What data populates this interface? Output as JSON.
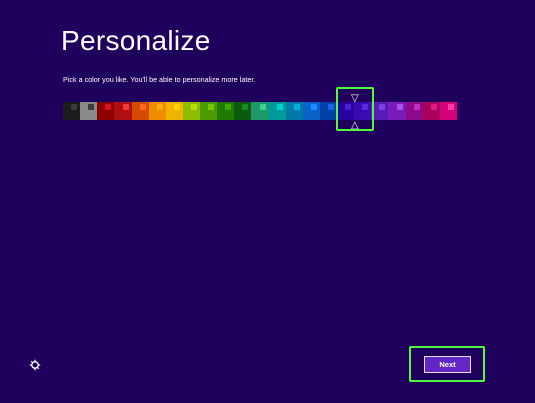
{
  "page": {
    "title": "Personalize",
    "subtitle": "Pick a color you like. You'll be able to personalize more later."
  },
  "colors": {
    "background": "#1f005d",
    "highlight": "#4cff3a",
    "button_fill": "#6327c8"
  },
  "swatches": [
    {
      "base": "#1c1c1c",
      "accent": "#3a3a3a"
    },
    {
      "base": "#8a8a8a",
      "accent": "#3d3d3d"
    },
    {
      "base": "#8b0000",
      "accent": "#d4131f"
    },
    {
      "base": "#b00f0f",
      "accent": "#ef3a3a"
    },
    {
      "base": "#d44a00",
      "accent": "#ff6b1a"
    },
    {
      "base": "#f08c00",
      "accent": "#ffb000"
    },
    {
      "base": "#f0b400",
      "accent": "#ffd200"
    },
    {
      "base": "#8dbc00",
      "accent": "#b5e000"
    },
    {
      "base": "#4a9a00",
      "accent": "#76c800"
    },
    {
      "base": "#1f7a00",
      "accent": "#42a900"
    },
    {
      "base": "#0a5a12",
      "accent": "#168d1c"
    },
    {
      "base": "#1e9a6a",
      "accent": "#3fcf92"
    },
    {
      "base": "#009a9a",
      "accent": "#00cfcf"
    },
    {
      "base": "#007aa8",
      "accent": "#00b0e0"
    },
    {
      "base": "#0a63c8",
      "accent": "#1a8cff"
    },
    {
      "base": "#0040a8",
      "accent": "#1a66e0"
    },
    {
      "base": "#2b00a0",
      "accent": "#4b1fd0"
    },
    {
      "base": "#3a0bb0",
      "accent": "#5a2be0"
    },
    {
      "base": "#5a1ab8",
      "accent": "#7d3fe0"
    },
    {
      "base": "#7a1ab8",
      "accent": "#a84fe8"
    },
    {
      "base": "#8a0a8a",
      "accent": "#c02fc0"
    },
    {
      "base": "#a8005a",
      "accent": "#e0188a"
    },
    {
      "base": "#d4007a",
      "accent": "#ff3aaa"
    }
  ],
  "selection": {
    "caret_top": "▽",
    "caret_bottom": "△",
    "selected_index": 16
  },
  "footer": {
    "ease_icon": "ease-of-access-icon",
    "next_label": "Next"
  }
}
